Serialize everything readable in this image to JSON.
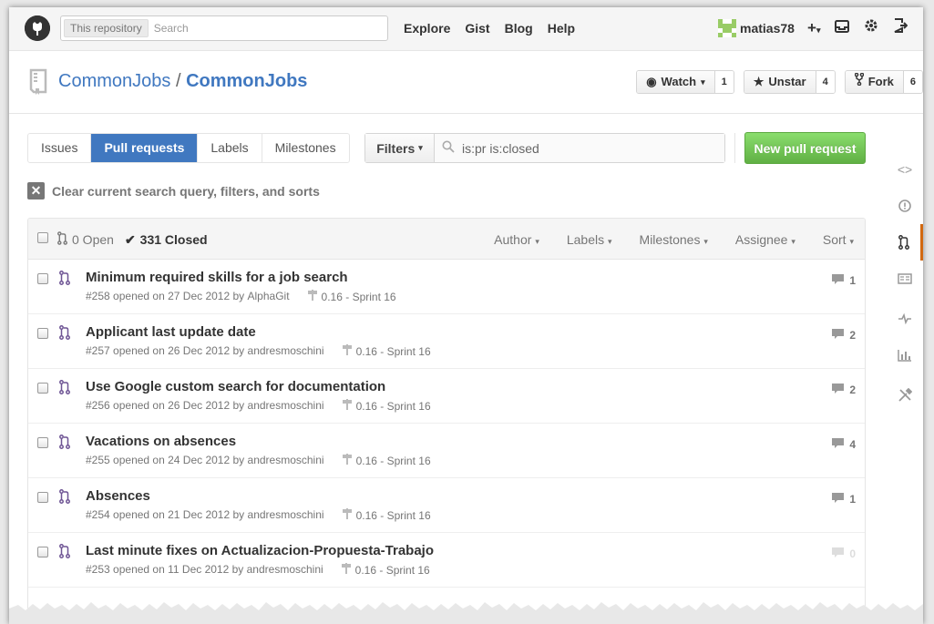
{
  "header": {
    "search_scope": "This repository",
    "search_placeholder": "Search",
    "nav": [
      "Explore",
      "Gist",
      "Blog",
      "Help"
    ],
    "username": "matias78"
  },
  "repo": {
    "owner": "CommonJobs",
    "separator": "/",
    "name": "CommonJobs",
    "watch_label": "Watch",
    "watch_count": "1",
    "star_label": "Unstar",
    "star_count": "4",
    "fork_label": "Fork",
    "fork_count": "6"
  },
  "subnav": {
    "tabs": [
      "Issues",
      "Pull requests",
      "Labels",
      "Milestones"
    ],
    "selected": "Pull requests"
  },
  "filters": {
    "button_label": "Filters",
    "query": "is:pr is:closed"
  },
  "new_pr_label": "New pull request",
  "clear_label": "Clear current search query, filters, and sorts",
  "list": {
    "open_label": "0 Open",
    "closed_label": "331 Closed",
    "sort_menus": [
      "Author",
      "Labels",
      "Milestones",
      "Assignee",
      "Sort"
    ],
    "items": [
      {
        "title": "Minimum required skills for a job search",
        "number": "#258",
        "opened": "opened on 27 Dec 2012 by",
        "author": "AlphaGit",
        "milestone": "0.16 - Sprint 16",
        "comments": "1"
      },
      {
        "title": "Applicant last update date",
        "number": "#257",
        "opened": "opened on 26 Dec 2012 by",
        "author": "andresmoschini",
        "milestone": "0.16 - Sprint 16",
        "comments": "2"
      },
      {
        "title": "Use Google custom search for documentation",
        "number": "#256",
        "opened": "opened on 26 Dec 2012 by",
        "author": "andresmoschini",
        "milestone": "0.16 - Sprint 16",
        "comments": "2"
      },
      {
        "title": "Vacations on absences",
        "number": "#255",
        "opened": "opened on 24 Dec 2012 by",
        "author": "andresmoschini",
        "milestone": "0.16 - Sprint 16",
        "comments": "4"
      },
      {
        "title": "Absences",
        "number": "#254",
        "opened": "opened on 21 Dec 2012 by",
        "author": "andresmoschini",
        "milestone": "0.16 - Sprint 16",
        "comments": "1"
      },
      {
        "title": "Last minute fixes on Actualizacion-Propuesta-Trabajo",
        "number": "#253",
        "opened": "opened on 11 Dec 2012 by",
        "author": "andresmoschini",
        "milestone": "0.16 - Sprint 16",
        "comments": "0"
      }
    ]
  },
  "colors": {
    "accent": "#4078c0",
    "green": "#60b044",
    "pr_icon": "#6e5494",
    "active_tab_bar": "#d26911"
  },
  "icons": [
    "github-logo-icon",
    "search-icon",
    "plus-icon",
    "inbox-icon",
    "gear-icon",
    "sign-out-icon",
    "book-icon",
    "eye-icon",
    "star-icon",
    "fork-icon",
    "code-icon",
    "issue-icon",
    "pull-request-icon",
    "wiki-icon",
    "pulse-icon",
    "graph-icon",
    "settings-icon",
    "check-icon",
    "comment-icon",
    "milestone-icon",
    "close-icon"
  ]
}
